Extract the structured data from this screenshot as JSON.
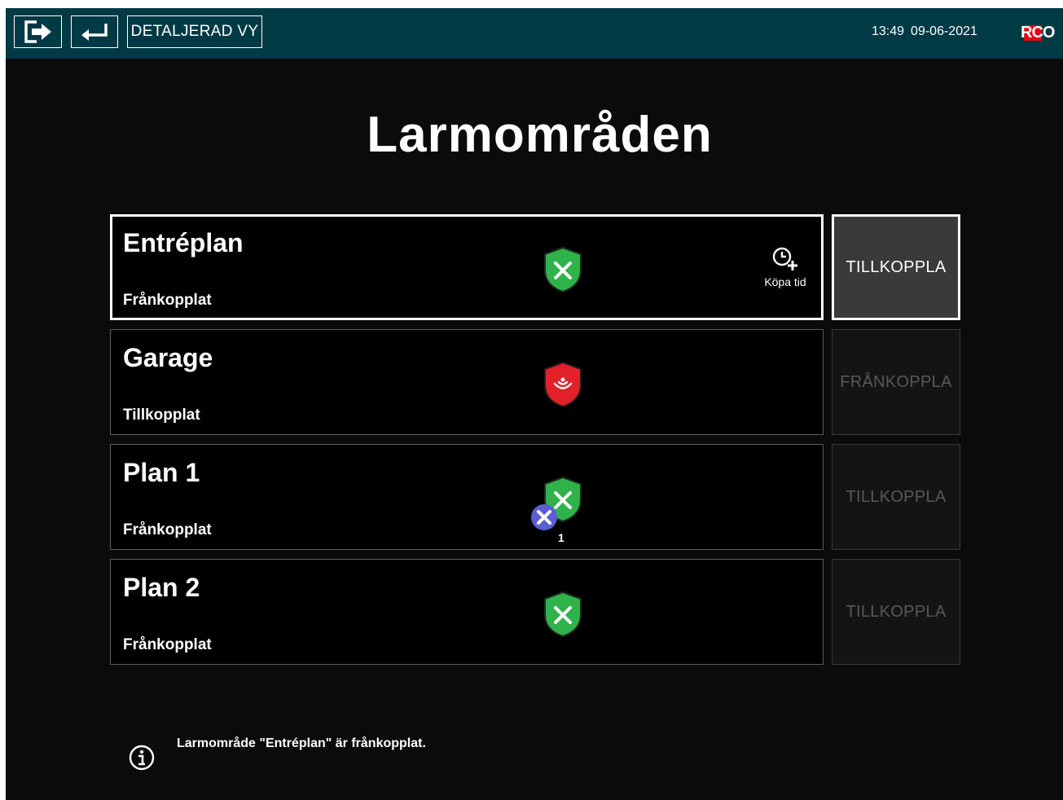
{
  "topbar": {
    "logout_icon": "logout-arrow-icon",
    "back_icon": "return-arrow-icon",
    "detail_view_label": "DETALJERAD VY",
    "time": "13:49",
    "date": "09-06-2021",
    "logo": "RCO",
    "background_color": "#003a45"
  },
  "page": {
    "title": "Larmområden"
  },
  "areas": [
    {
      "name": "Entréplan",
      "status": "Frånkopplat",
      "shield_state": "disarmed",
      "shield_color": "#2fb24a",
      "selected": true,
      "buy_time_label": "Köpa tid",
      "action_label": "TILLKOPPLA",
      "action_enabled": true
    },
    {
      "name": "Garage",
      "status": "Tillkopplat",
      "shield_state": "armed",
      "shield_color": "#e3212b",
      "selected": false,
      "action_label": "FRÅNKOPPLA",
      "action_enabled": false
    },
    {
      "name": "Plan 1",
      "status": "Frånkopplat",
      "shield_state": "disarmed",
      "shield_color": "#2fb24a",
      "selected": false,
      "fault_badge_color": "#5a5fd0",
      "fault_count": "1",
      "action_label": "TILLKOPPLA",
      "action_enabled": false
    },
    {
      "name": "Plan 2",
      "status": "Frånkopplat",
      "shield_state": "disarmed",
      "shield_color": "#2fb24a",
      "selected": false,
      "action_label": "TILLKOPPLA",
      "action_enabled": false
    }
  ],
  "info": {
    "icon": "info-icon",
    "message": "Larmområde \"Entréplan\" är frånkopplat."
  }
}
